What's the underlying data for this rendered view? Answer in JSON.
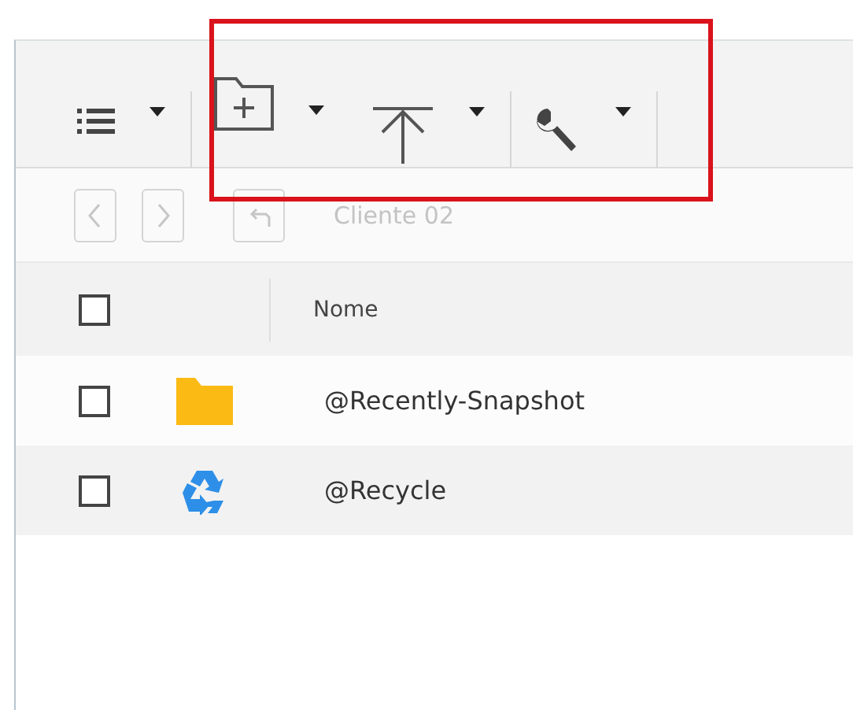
{
  "toolbar": {
    "items": [
      {
        "kind": "view-list",
        "divider": true
      },
      {
        "kind": "new-folder",
        "divider": false
      },
      {
        "kind": "upload",
        "divider": true
      },
      {
        "kind": "tools",
        "divider": true
      }
    ]
  },
  "navigation": {
    "buttons": [
      {
        "kind": "back",
        "disabled": true
      },
      {
        "kind": "forward",
        "disabled": true
      },
      {
        "kind": "up",
        "disabled": true
      }
    ],
    "path": {
      "text": "Cliente 02",
      "disabled": true
    }
  },
  "table": {
    "select_all": {
      "checked": false
    },
    "columns": [
      "Nome"
    ],
    "rows": [
      {
        "kind": "folder",
        "name": "@Recently-Snapshot",
        "checked": false
      },
      {
        "kind": "recycle",
        "name": "@Recycle",
        "checked": false
      }
    ]
  }
}
